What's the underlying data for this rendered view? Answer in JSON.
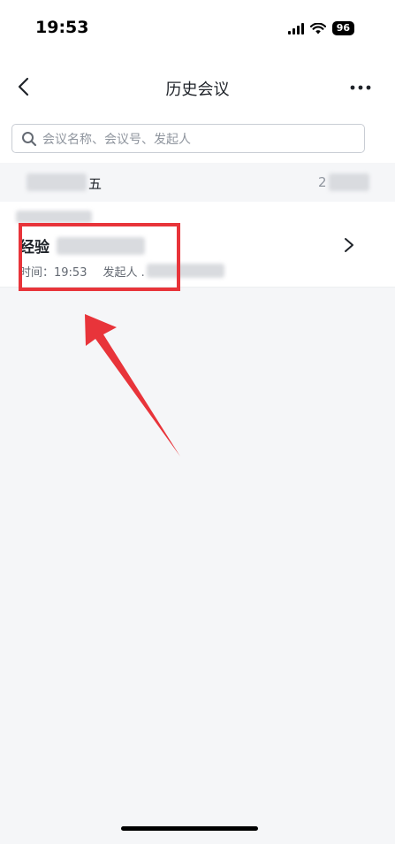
{
  "status_bar": {
    "time": "19:53",
    "battery": "96"
  },
  "nav": {
    "title": "历史会议"
  },
  "search": {
    "placeholder": "会议名称、会议号、发起人"
  },
  "group": {
    "weekday": "五",
    "year": "2"
  },
  "meeting": {
    "title": "经验",
    "time_text": "时间：19:53",
    "initiator_text": "发起人 ."
  },
  "colors": {
    "highlight": "#e8343a",
    "background": "#f5f6f8"
  }
}
